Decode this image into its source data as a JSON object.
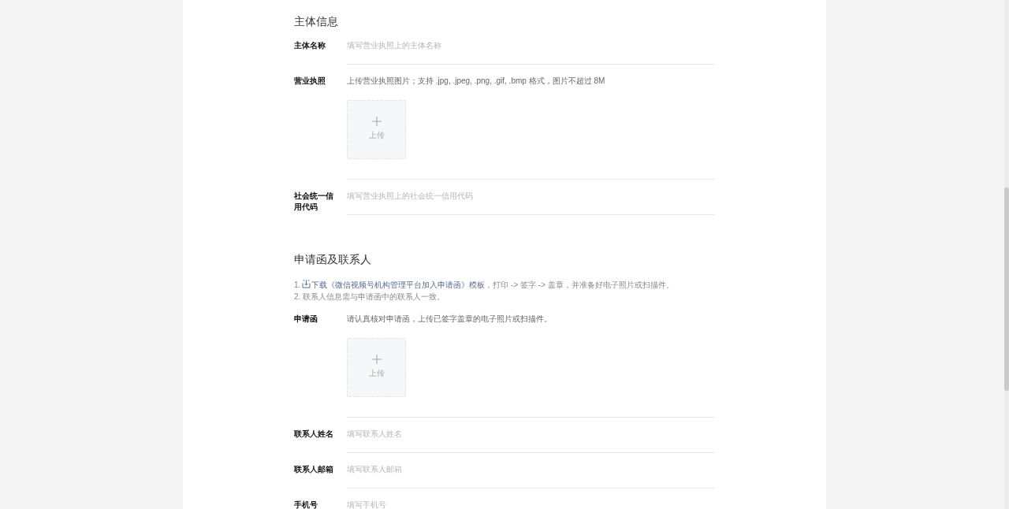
{
  "sections": [
    {
      "title": "主体信息",
      "fields": [
        {
          "kind": "text",
          "label": "主体名称",
          "placeholder": "填写营业执照上的主体名称"
        },
        {
          "kind": "upload",
          "label": "营业执照",
          "hint": "上传营业执照图片；支持 .jpg, .jpeg, .png, .gif, .bmp 格式，图片不超过 8M",
          "upload_label": "上传"
        },
        {
          "kind": "text",
          "label": "社会统一信用代码",
          "placeholder": "填写营业执照上的社会统一信用代码"
        }
      ]
    },
    {
      "title": "申请函及联系人",
      "notes": [
        {
          "number": "1.",
          "link": "下载《微信视频号机构管理平台加入申请函》模板",
          "text": "，打印 -> 签字 -> 盖章，并准备好电子照片或扫描件。"
        },
        {
          "text": "2. 联系人信息需与申请函中的联系人一致。"
        }
      ],
      "fields": [
        {
          "kind": "upload",
          "label": "申请函",
          "hint": "请认真核对申请函，上传已签字盖章的电子照片或扫描件。",
          "upload_label": "上传"
        },
        {
          "kind": "text",
          "label": "联系人姓名",
          "placeholder": "填写联系人姓名"
        },
        {
          "kind": "text",
          "label": "联系人邮箱",
          "placeholder": "填写联系人邮箱"
        },
        {
          "kind": "text",
          "label": "手机号",
          "placeholder": "填写手机号"
        }
      ]
    }
  ]
}
